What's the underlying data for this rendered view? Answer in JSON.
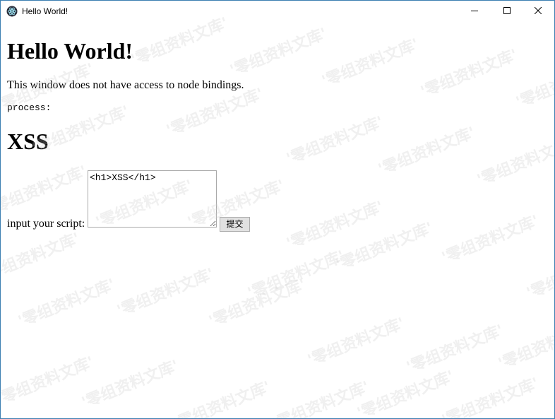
{
  "window": {
    "title": "Hello World!",
    "app_icon": "electron-icon",
    "controls": {
      "minimize_icon": "minimize-icon",
      "maximize_icon": "maximize-icon",
      "close_icon": "close-icon"
    }
  },
  "page": {
    "heading": "Hello World!",
    "paragraph": "This window does not have access to node bindings.",
    "process_line": "process:",
    "xss_heading": "XSS",
    "form": {
      "label": "input your script:",
      "textarea_value": "<h1>XSS</h1>",
      "submit_label": "提交"
    }
  },
  "watermark": {
    "text": "'零组资料文库'",
    "color": "#c8c8c8"
  }
}
